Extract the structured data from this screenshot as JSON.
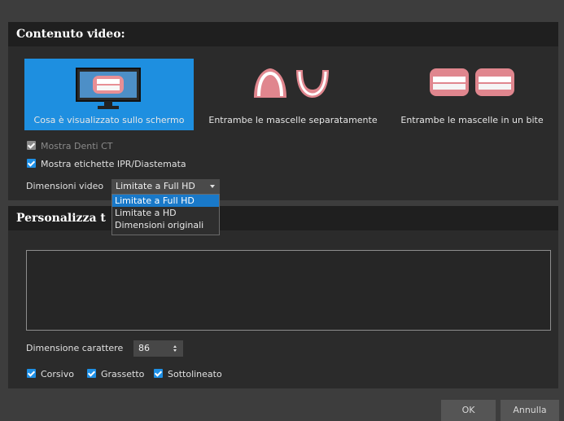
{
  "video_section": {
    "title": "Contenuto video:",
    "options": [
      {
        "label": "Cosa è visualizzato sullo schermo",
        "icon": "monitor-teeth-icon",
        "selected": true
      },
      {
        "label": "Entrambe le mascelle separatamente",
        "icon": "separate-jaws-icon",
        "selected": false
      },
      {
        "label": "Entrambe le mascelle in un bite",
        "icon": "jaws-in-bite-icon",
        "selected": false
      }
    ],
    "checkboxes": [
      {
        "label": "Mostra Denti CT",
        "checked": true,
        "disabled": true
      },
      {
        "label": "Mostra etichette IPR/Diastemata",
        "checked": true,
        "disabled": false
      }
    ],
    "video_size": {
      "label": "Dimensioni video",
      "value": "Limitate a Full HD",
      "options": [
        "Limitate a Full HD",
        "Limitate a HD",
        "Dimensioni originali"
      ]
    }
  },
  "text_section": {
    "title": "Personalizza t",
    "font_size_label": "Dimensione carattere",
    "font_size_value": "86",
    "styles": [
      {
        "label": "Corsivo",
        "checked": true
      },
      {
        "label": "Grassetto",
        "checked": true
      },
      {
        "label": "Sottolineato",
        "checked": true
      }
    ]
  },
  "footer": {
    "ok_label": "OK",
    "cancel_label": "Annulla"
  },
  "colors": {
    "accent": "#1e8fe0",
    "dialog_bg": "#3d3d3d",
    "panel_bg": "#2b2b2b",
    "header_bg": "#1f1f1f"
  }
}
